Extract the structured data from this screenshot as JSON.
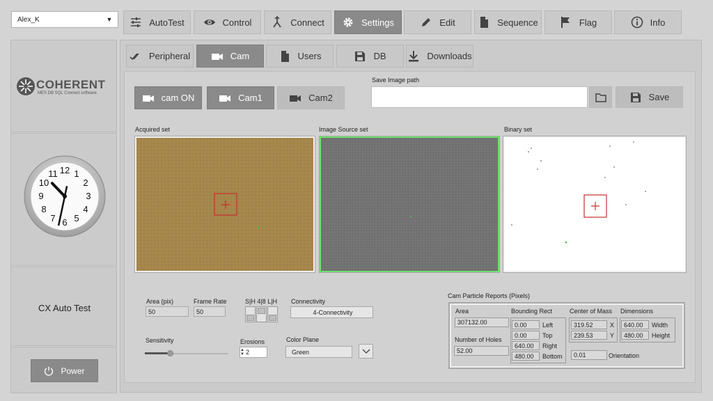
{
  "user": {
    "selected": "Alex_K"
  },
  "top_nav": [
    {
      "label": "AutoTest",
      "icon": "sliders-icon"
    },
    {
      "label": "Control",
      "icon": "eye-icon"
    },
    {
      "label": "Connect",
      "icon": "connect-icon"
    },
    {
      "label": "Settings",
      "icon": "gear-icon"
    },
    {
      "label": "Edit",
      "icon": "pencil-icon"
    },
    {
      "label": "Sequence",
      "icon": "document-icon"
    },
    {
      "label": "Flag",
      "icon": "flag-icon"
    },
    {
      "label": "Info",
      "icon": "info-icon"
    }
  ],
  "sub_tabs": [
    {
      "label": "Peripheral"
    },
    {
      "label": "Cam"
    },
    {
      "label": "Users"
    },
    {
      "label": "DB"
    },
    {
      "label": "Downloads"
    }
  ],
  "logo": {
    "name": "COHERENT",
    "tagline": "MES DB SQL Connect software"
  },
  "app_title": "CX Auto Test",
  "power_label": "Power",
  "cam": {
    "on_label": "cam ON",
    "cam1_label": "Cam1",
    "cam2_label": "Cam2"
  },
  "save": {
    "path_label": "Save Image path",
    "path_value": "",
    "save_label": "Save"
  },
  "views": {
    "acquired": "Acquired set",
    "source": "Image Source set",
    "binary": "Binary set"
  },
  "params": {
    "area_label": "Area (pix)",
    "area_value": "50",
    "frame_rate_label": "Frame Rate",
    "frame_rate_value": "50",
    "bits_label": "S|H 4|8 L|H",
    "connectivity_label": "Connectivity",
    "connectivity_value": "4-Connectivity",
    "sensitivity_label": "Sensitivity",
    "sensitivity_level": 0.3,
    "erosions_label": "Erosions",
    "erosions_value": "2",
    "color_plane_label": "Color Plane",
    "color_plane_value": "Green"
  },
  "report": {
    "title": "Cam Particle Reports (Pixels)",
    "area_label": "Area",
    "area_value": "307132.00",
    "holes_label": "Number of Holes",
    "holes_value": "52.00",
    "bounding_label": "Bounding Rect",
    "bounding": [
      {
        "value": "0.00",
        "label": "Left"
      },
      {
        "value": "0.00",
        "label": "Top"
      },
      {
        "value": "640.00",
        "label": "Right"
      },
      {
        "value": "480.00",
        "label": "Bottom"
      }
    ],
    "com_label": "Center of Mass",
    "com": [
      {
        "value": "319.52",
        "label": "X"
      },
      {
        "value": "239.53",
        "label": "Y"
      }
    ],
    "dim_label": "Dimensions",
    "dims": [
      {
        "value": "640.00",
        "label": "Width"
      },
      {
        "value": "480.00",
        "label": "Height"
      }
    ],
    "orientation_value": "0.01",
    "orientation_label": "Orientation"
  },
  "clock": {
    "hour": 10,
    "minute": 32
  },
  "colors": {
    "acquired": "#a2844a",
    "source": "#717171",
    "marker": "#d42a2a"
  }
}
